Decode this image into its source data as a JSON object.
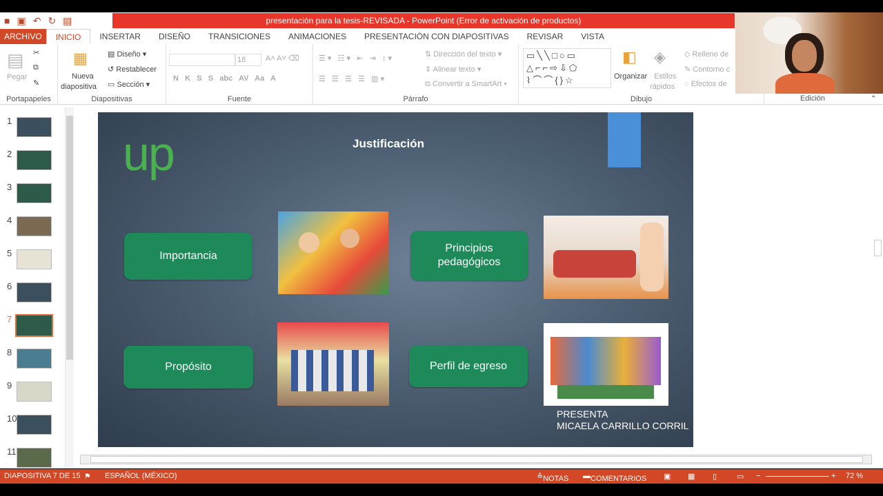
{
  "window": {
    "title": "presentación para la tesis-REVISADA - PowerPoint (Error de activación de productos)"
  },
  "tabs": [
    "ARCHIVO",
    "INICIO",
    "INSERTAR",
    "DISEÑO",
    "TRANSICIONES",
    "ANIMACIONES",
    "PRESENTACIÓN CON DIAPOSITIVAS",
    "REVISAR",
    "VISTA"
  ],
  "ribbon": {
    "portapapeles": {
      "label": "Portapapeles",
      "pegar": "Pegar"
    },
    "diapositivas": {
      "label": "Diapositivas",
      "nueva": "Nueva",
      "nueva2": "diapositiva",
      "diseno": "Diseño",
      "restablecer": "Restablecer",
      "seccion": "Sección"
    },
    "fuente": {
      "label": "Fuente",
      "size": "18"
    },
    "parrafo": {
      "label": "Párrafo",
      "direccion": "Dirección del texto",
      "alinear": "Alinear texto",
      "convertir": "Convertir a SmartArt"
    },
    "dibujo": {
      "label": "Dibujo",
      "organizar": "Organizar",
      "estilos1": "Estilos",
      "estilos2": "rápidos",
      "relleno": "Relleno de",
      "contorno": "Contorno c",
      "efectos": "Efectos de"
    },
    "edicion": {
      "label": "Edición"
    }
  },
  "thumbnails": [
    "1",
    "2",
    "3",
    "4",
    "5",
    "6",
    "7",
    "8",
    "9",
    "10",
    "11"
  ],
  "slide": {
    "logo": "up",
    "title": "Justificación",
    "buttons": {
      "importancia": "Importancia",
      "principios": "Principios pedagógicos",
      "proposito": "Propósito",
      "perfil": "Perfil de egreso"
    },
    "presenta1": "PRESENTA",
    "presenta2": "MICAELA CARRILLO CORRIL"
  },
  "status": {
    "slide": "DIAPOSITIVA 7 DE 15",
    "lang": "ESPAÑOL (MÉXICO)",
    "notas": "NOTAS",
    "comentarios": "COMENTARIOS",
    "zoom": "72 %"
  }
}
